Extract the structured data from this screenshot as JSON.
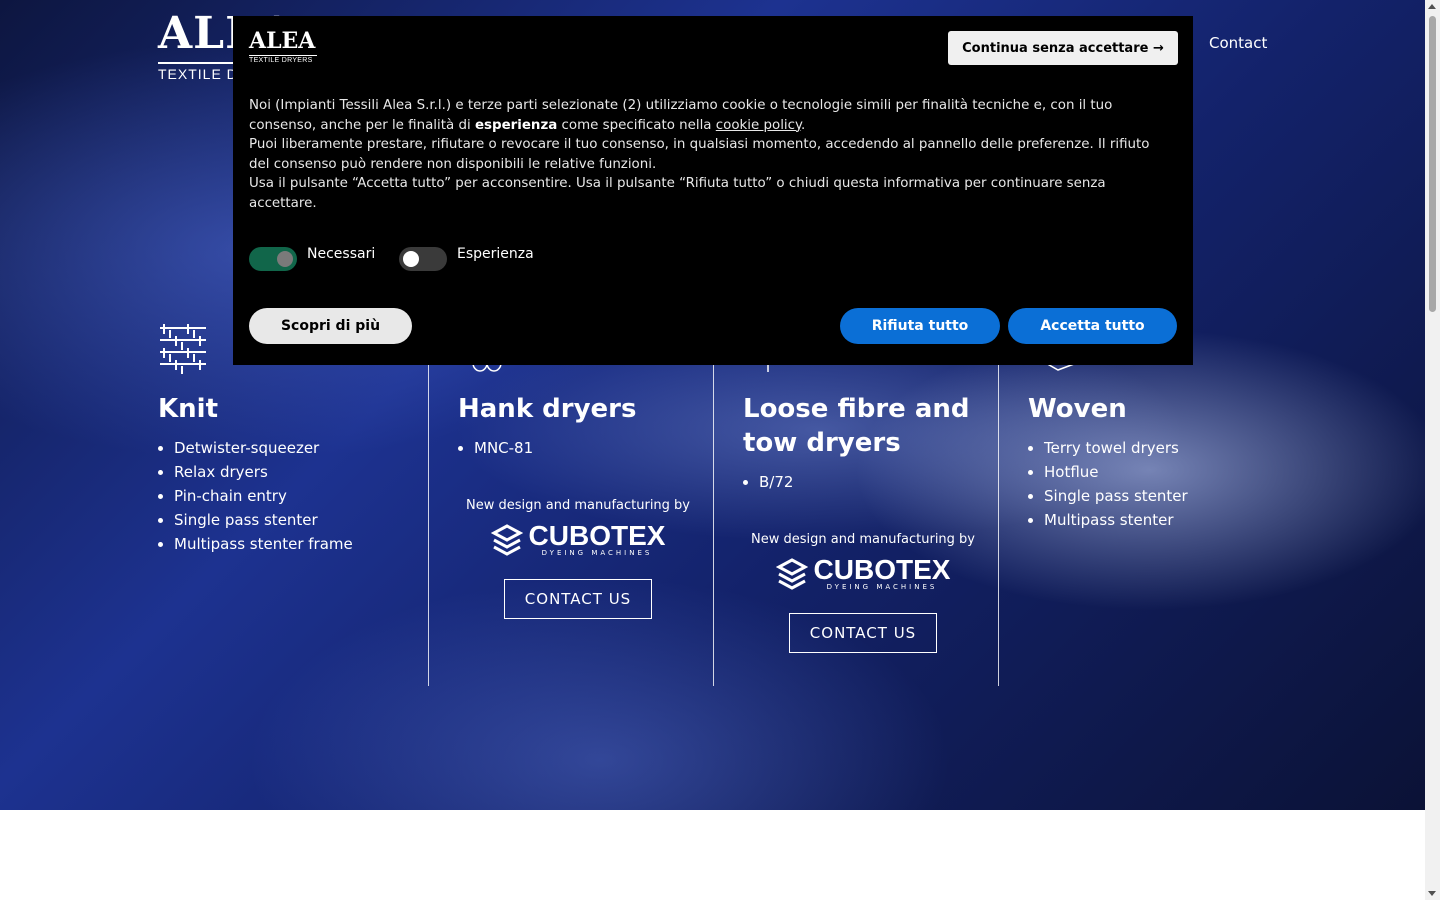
{
  "header": {
    "logo_big": "ALEA",
    "logo_sub": "TEXTILE DRYERS",
    "nav_contact": "Contact"
  },
  "columns": [
    {
      "title": "Knit",
      "icon": "knit-pattern-icon",
      "items": [
        "Detwister-squeezer",
        "Relax dryers",
        "Pin-chain entry",
        "Single pass stenter",
        "Multipass stenter frame"
      ]
    },
    {
      "title": "Hank dryers",
      "icon": "hank-icon",
      "items": [
        "MNC-81"
      ],
      "by_text": "New design and manufacturing by",
      "brand": "CUBOTEX",
      "brand_tag": "DYEING MACHINES",
      "cta": "CONTACT US"
    },
    {
      "title_line1": "Loose fibre and",
      "title_line2": "tow dryers",
      "icon": "fibre-icon",
      "items": [
        "B/72"
      ],
      "by_text": "New design and manufacturing by",
      "brand": "CUBOTEX",
      "brand_tag": "DYEING MACHINES",
      "cta": "CONTACT US"
    },
    {
      "title": "Woven",
      "icon": "woven-icon",
      "items": [
        "Terry towel dryers",
        "Hotflue",
        "Single pass stenter",
        "Multipass stenter"
      ]
    }
  ],
  "cookie": {
    "logo_big": "ALEA",
    "logo_sub": "TEXTILE DRYERS",
    "continue_label": "Continua senza accettare →",
    "p1_a": "Noi (Impianti Tessili Alea S.r.l.) e terze parti selezionate (2) utilizziamo cookie o tecnologie simili per finalità tecniche e, con il tuo consenso, anche per le finalità di ",
    "p1_bold": "esperienza",
    "p1_b": " come specificato nella ",
    "p1_link": "cookie policy",
    "p1_c": ".",
    "p2": "Puoi liberamente prestare, rifiutare o revocare il tuo consenso, in qualsiasi momento, accedendo al pannello delle preferenze. Il rifiuto del consenso può rendere non disponibili le relative funzioni.",
    "p3": "Usa il pulsante “Accetta tutto” per acconsentire. Usa il pulsante “Rifiuta tutto” o chiudi questa informativa per continuare senza accettare.",
    "toggle1_label": "Necessari",
    "toggle2_label": "Esperienza",
    "scopri_label": "Scopri di più",
    "rifiuta_label": "Rifiuta tutto",
    "accetta_label": "Accetta tutto",
    "accent_color": "#0b6fd6"
  }
}
